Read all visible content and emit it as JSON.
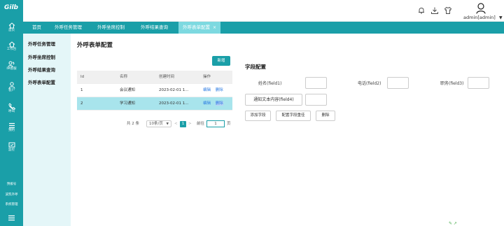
{
  "logo": {
    "text": "Gilb"
  },
  "rail": {
    "items": [
      {
        "label": "首页",
        "icon": "home-icon"
      },
      {
        "label": "工作台",
        "icon": "workbench-icon"
      },
      {
        "label": "IM客服",
        "icon": "im-service-icon"
      },
      {
        "label": "客户",
        "icon": "customer-icon"
      },
      {
        "label": "呼叫",
        "icon": "call-icon"
      },
      {
        "label": "预约",
        "icon": "appointment-icon"
      },
      {
        "label": "监控",
        "icon": "monitor-icon"
      }
    ],
    "bottom_items": [
      "预拨号",
      "波凯外呼",
      "系统管理"
    ]
  },
  "header": {
    "icons": [
      "bell-icon",
      "download-icon",
      "shirt-icon"
    ],
    "username": "admin[admin]"
  },
  "tabs": [
    {
      "label": "首页"
    },
    {
      "label": "外呼任务管理"
    },
    {
      "label": "外呼坐席控制"
    },
    {
      "label": "外呼结果查询"
    },
    {
      "label": "外呼表单配置",
      "active": true,
      "close": "×"
    }
  ],
  "submenu": {
    "items": [
      "外呼任务管理",
      "外呼坐席控制",
      "外呼结果查询",
      "外呼表单配置"
    ]
  },
  "page": {
    "title": "外呼表单配置",
    "new_button": "新增"
  },
  "table": {
    "headers": [
      "Id",
      "名称",
      "创建时间",
      "操作"
    ],
    "rows": [
      {
        "id": "1",
        "name": "会议通知",
        "time": "2023-02-01 1...",
        "edit": "编辑",
        "del": "删除",
        "selected": false
      },
      {
        "id": "2",
        "name": "学习通知",
        "time": "2023-02-01 1...",
        "edit": "编辑",
        "del": "删除",
        "selected": true
      }
    ]
  },
  "pager": {
    "total": "共 2 条",
    "page_size": "10条/页",
    "prev": "<",
    "current": "1",
    "next": ">",
    "goto_label": "前往",
    "goto_value": "1",
    "unit": "页"
  },
  "field_config": {
    "title": "字段配置",
    "field1_label": "姓名(field1)",
    "field2_label": "电话(field2)",
    "field3_label": "职务(field3)",
    "field4_label": "通知文本内容(field4)",
    "add_button": "添加字段",
    "reset_button": "配置字段重佳",
    "delete_button": "删除"
  },
  "colors": {
    "brand": "#1a9fa8",
    "active_tab": "#7dd9e0",
    "submenu_bg": "#e4f6f8",
    "selected_row": "#a8e4ec",
    "link": "#2a7ae2"
  }
}
